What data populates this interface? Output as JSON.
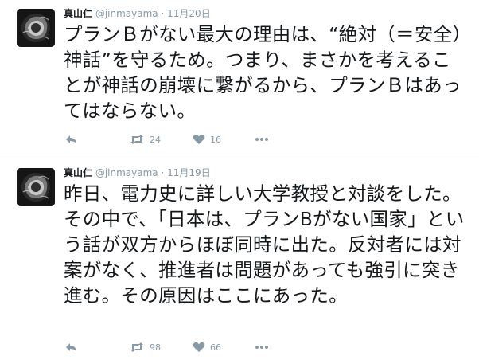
{
  "tweets": [
    {
      "name": "真山仁",
      "handle": "@jinmayama",
      "separator": "·",
      "date": "11月20日",
      "text": "プランＢがない最大の理由は、“絶対（＝安全）神話”を守るため。つまり、まさかを考えることが神話の崩壊に繋がるから、プランＢはあってはならない。",
      "retweets": "24",
      "likes": "16"
    },
    {
      "name": "真山仁",
      "handle": "@jinmayama",
      "separator": "·",
      "date": "11月19日",
      "text": "昨日、電力史に詳しい大学教授と対談をした。その中で、「日本は、プランBがない国家」という話が双方からほぼ同時に出た。反対者には対案がなく、推進者は問題があっても強引に突き進む。その原因はここにあった。",
      "retweets": "98",
      "likes": "66"
    }
  ],
  "icons": {
    "reply": "reply-icon",
    "retweet": "retweet-icon",
    "like": "heart-icon",
    "more": "more-icon"
  },
  "colors": {
    "text": "#14171a",
    "muted": "#8899a6",
    "divider": "#e6ecf0"
  }
}
